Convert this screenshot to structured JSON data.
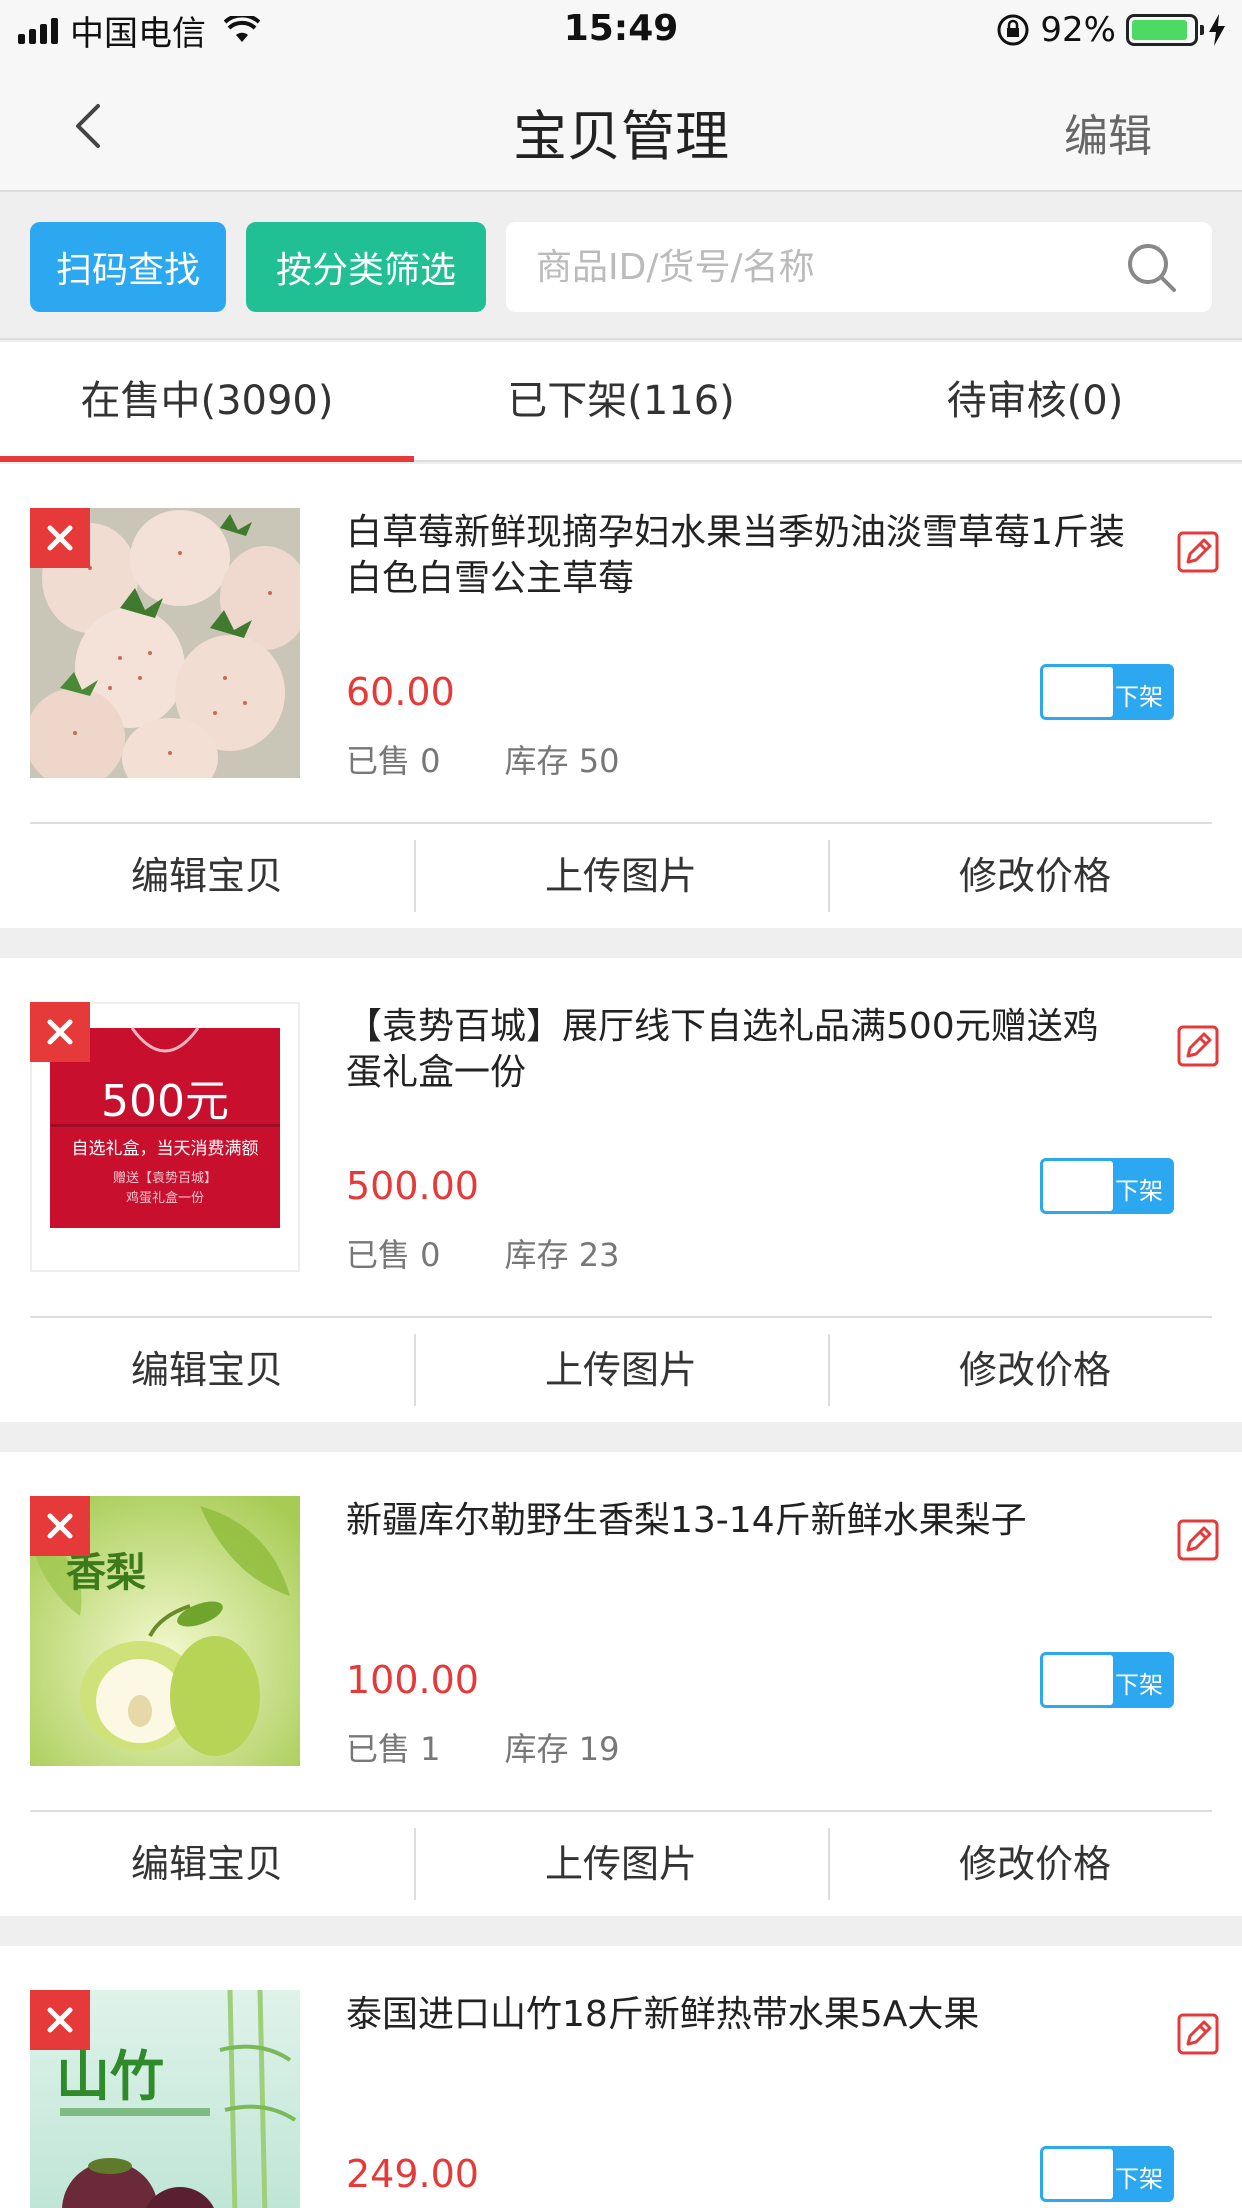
{
  "status_bar": {
    "carrier": "中国电信",
    "time": "15:49",
    "battery": "92%"
  },
  "nav": {
    "title": "宝贝管理",
    "edit": "编辑"
  },
  "search": {
    "scan_label": "扫码查找",
    "category_label": "按分类筛选",
    "placeholder": "商品ID/货号/名称"
  },
  "tabs": [
    {
      "label": "在售中(3090)",
      "active": true
    },
    {
      "label": "已下架(116)",
      "active": false
    },
    {
      "label": "待审核(0)",
      "active": false
    }
  ],
  "product_actions": {
    "edit": "编辑宝贝",
    "upload": "上传图片",
    "price": "修改价格"
  },
  "toggle_label": "下架",
  "products": [
    {
      "title": "白草莓新鲜现摘孕妇水果当季奶油淡雪草莓1斤装白色白雪公主草莓",
      "price": "60.00",
      "sold": "已售 0",
      "stock": "库存 50",
      "image": "strawberry"
    },
    {
      "title": "【袁势百城】展厅线下自选礼品满500元赠送鸡蛋礼盒一份",
      "price": "500.00",
      "sold": "已售 0",
      "stock": "库存 23",
      "image": "giftbox",
      "image_text": {
        "main": "500元",
        "line1": "自选礼盒，当天消费满额",
        "line2": "赠送【袁势百城】",
        "line3": "鸡蛋礼盒一份"
      }
    },
    {
      "title": "新疆库尔勒野生香梨13-14斤新鲜水果梨子",
      "price": "100.00",
      "sold": "已售 1",
      "stock": "库存 19",
      "image": "pear",
      "image_text": {
        "main": "香梨"
      }
    },
    {
      "title": "泰国进口山竹18斤新鲜热带水果5A大果",
      "price": "249.00",
      "sold": "",
      "stock": "",
      "image": "mangosteen",
      "image_text": {
        "main": "山竹"
      }
    }
  ]
}
